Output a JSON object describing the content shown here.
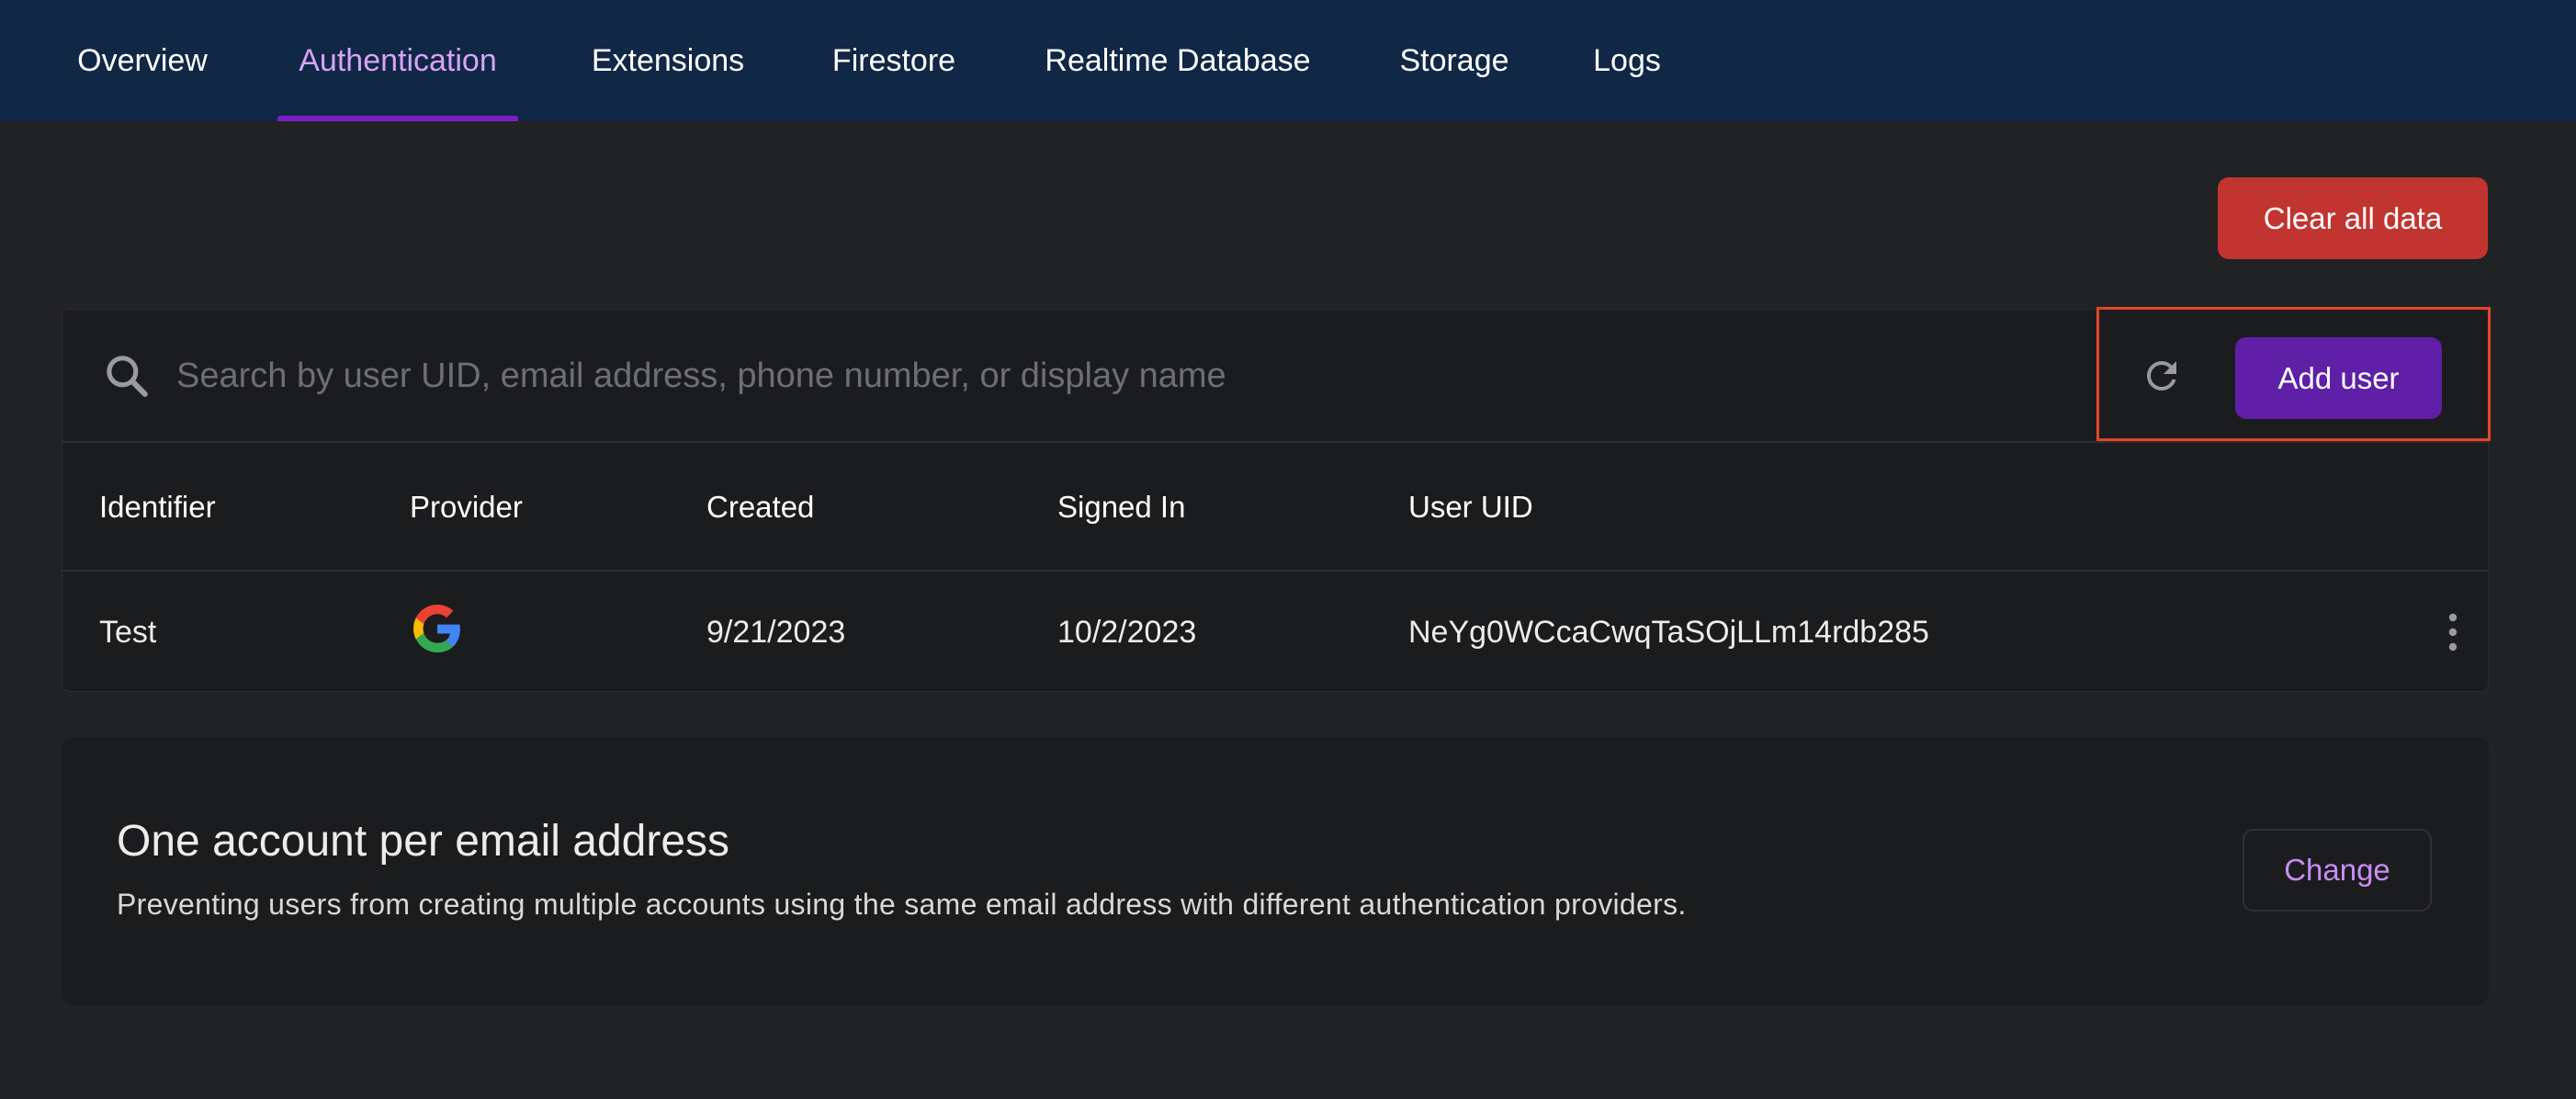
{
  "nav": {
    "tabs": [
      {
        "label": "Overview",
        "active": false
      },
      {
        "label": "Authentication",
        "active": true
      },
      {
        "label": "Extensions",
        "active": false
      },
      {
        "label": "Firestore",
        "active": false
      },
      {
        "label": "Realtime Database",
        "active": false
      },
      {
        "label": "Storage",
        "active": false
      },
      {
        "label": "Logs",
        "active": false
      }
    ]
  },
  "toolbar": {
    "clear_label": "Clear all data",
    "add_user_label": "Add user",
    "refresh_icon": "refresh-icon"
  },
  "search": {
    "placeholder": "Search by user UID, email address, phone number, or display name",
    "value": "",
    "icon": "search-icon"
  },
  "table": {
    "columns": [
      "Identifier",
      "Provider",
      "Created",
      "Signed In",
      "User UID"
    ],
    "rows": [
      {
        "identifier": "Test",
        "provider": "google",
        "provider_icon": "google-icon",
        "created": "9/21/2023",
        "signed_in": "10/2/2023",
        "uid": "NeYg0WCcaCwqTaSOjLLm14rdb285"
      }
    ]
  },
  "policy": {
    "title": "One account per email address",
    "description": "Preventing users from creating multiple accounts using the same email address with different authentication providers.",
    "change_label": "Change"
  },
  "colors": {
    "nav_bg": "#102745",
    "accent": "#7a1ec9",
    "active_tab_text": "#d7a4f7",
    "danger": "#c2342f",
    "primary": "#5f1fa7",
    "highlight": "#e2452b"
  }
}
